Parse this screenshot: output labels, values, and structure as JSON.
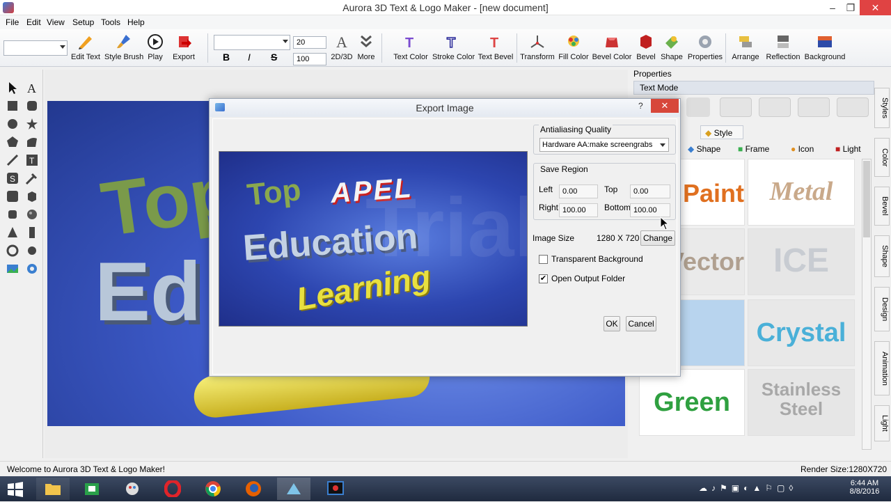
{
  "window": {
    "title": "Aurora 3D Text & Logo Maker - [new document]"
  },
  "menu": [
    "File",
    "Edit",
    "View",
    "Setup",
    "Tools",
    "Help"
  ],
  "toolbar": {
    "font_size": "20",
    "depth": "100",
    "bold": "B",
    "italic": "I",
    "strike": "S",
    "buttons": [
      "Edit Text",
      "Style Brush",
      "Play",
      "Export",
      "2D/3D",
      "More",
      "Text Color",
      "Stroke Color",
      "Text Bevel",
      "Transform",
      "Fill Color",
      "Bevel Color",
      "Bevel",
      "Shape",
      "Properties",
      "Arrange",
      "Reflection",
      "Background"
    ]
  },
  "properties": {
    "header": "Properties",
    "mode": "Text Mode",
    "tabs_row1": [
      "Style"
    ],
    "tabs_row2": [
      "Shape",
      "Frame",
      "Icon",
      "Light"
    ],
    "styles": [
      "Paint",
      "Metal",
      "Vector",
      "ICE",
      "Green",
      "Crystal",
      "Stainless Steel"
    ],
    "side_tabs": [
      "Styles",
      "Color",
      "Bevel",
      "Shape",
      "Design",
      "Animation",
      "Light"
    ]
  },
  "dialog": {
    "title": "Export Image",
    "help": "?",
    "antialias_label": "Antialiasing Quality",
    "antialias_value": "Hardware AA:make screengrabs",
    "save_region_label": "Save Region",
    "left_label": "Left",
    "left_value": "0.00",
    "top_label": "Top",
    "top_value": "0.00",
    "right_label": "Right",
    "right_value": "100.00",
    "bottom_label": "Bottom",
    "bottom_value": "100.00",
    "image_size_label": "Image Size",
    "image_size_value": "1280 X 720",
    "change_label": "Change",
    "transparent_label": "Transparent Background",
    "transparent_checked": false,
    "open_folder_label": "Open Output Folder",
    "open_folder_checked": true,
    "ok_label": "OK",
    "cancel_label": "Cancel",
    "preview_lines": [
      "Top",
      "APEL",
      "Education",
      "Learning"
    ],
    "watermark": "Trial"
  },
  "scene": {
    "text_top": "Top",
    "text_mid": "Ed"
  },
  "status": {
    "left": "Welcome to Aurora 3D Text & Logo Maker!",
    "right": "Render Size:1280X720"
  },
  "clock": {
    "time": "6:44 AM",
    "date": "8/8/2016"
  },
  "colors": {
    "accent": "#3d5ac8",
    "close": "#e04343"
  }
}
